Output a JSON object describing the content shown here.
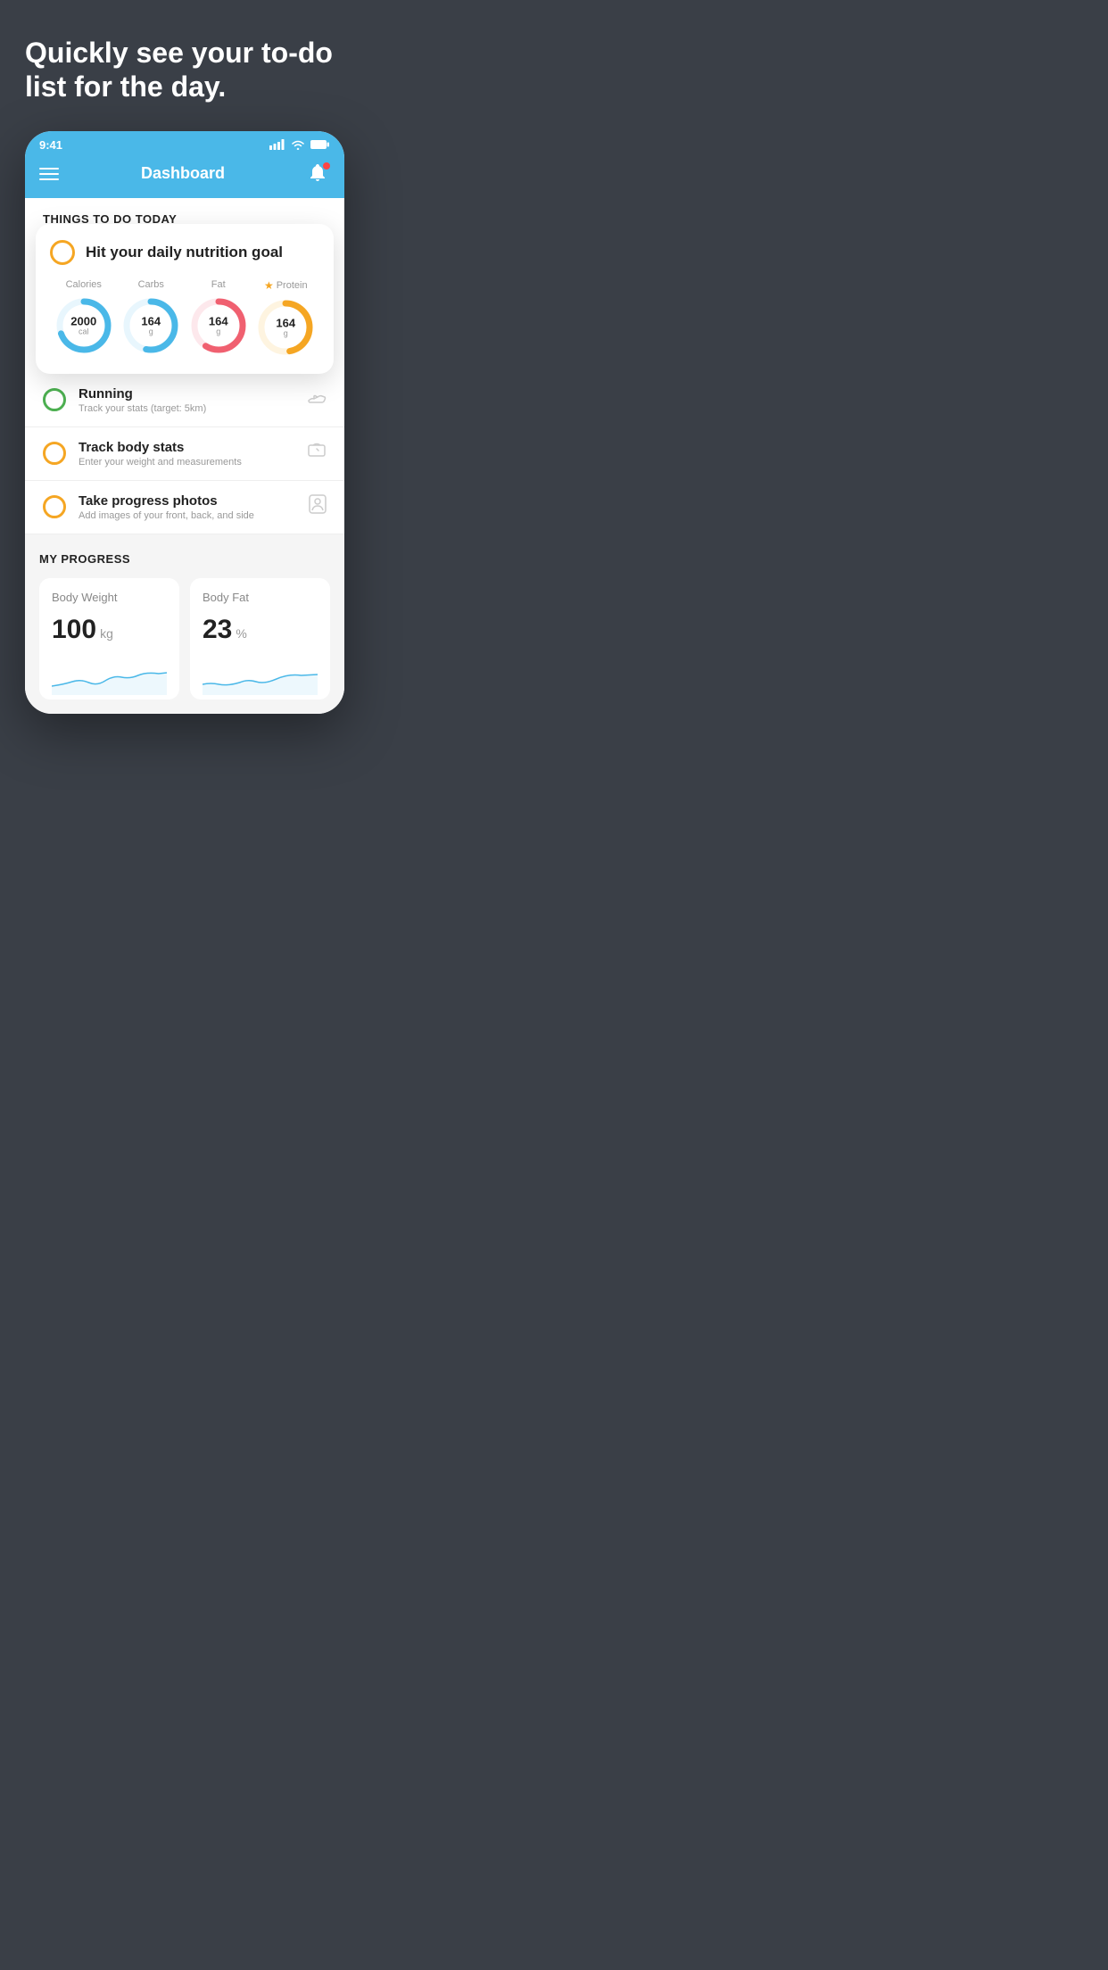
{
  "hero": {
    "text": "Quickly see your to-do list for the day."
  },
  "statusBar": {
    "time": "9:41"
  },
  "topBar": {
    "title": "Dashboard"
  },
  "thingsToday": {
    "header": "THINGS TO DO TODAY"
  },
  "nutritionCard": {
    "checkLabel": "",
    "title": "Hit your daily nutrition goal",
    "stats": [
      {
        "label": "Calories",
        "value": "2000",
        "unit": "cal",
        "color": "#4ab8e8",
        "star": false
      },
      {
        "label": "Carbs",
        "value": "164",
        "unit": "g",
        "color": "#4ab8e8",
        "star": false
      },
      {
        "label": "Fat",
        "value": "164",
        "unit": "g",
        "color": "#f06070",
        "star": false
      },
      {
        "label": "Protein",
        "value": "164",
        "unit": "g",
        "color": "#f5a623",
        "star": true
      }
    ]
  },
  "todoItems": [
    {
      "title": "Running",
      "subtitle": "Track your stats (target: 5km)",
      "circleColor": "green",
      "icon": "shoe"
    },
    {
      "title": "Track body stats",
      "subtitle": "Enter your weight and measurements",
      "circleColor": "yellow",
      "icon": "scale"
    },
    {
      "title": "Take progress photos",
      "subtitle": "Add images of your front, back, and side",
      "circleColor": "yellow",
      "icon": "person"
    }
  ],
  "progress": {
    "header": "MY PROGRESS",
    "cards": [
      {
        "title": "Body Weight",
        "value": "100",
        "unit": "kg"
      },
      {
        "title": "Body Fat",
        "value": "23",
        "unit": "%"
      }
    ]
  }
}
